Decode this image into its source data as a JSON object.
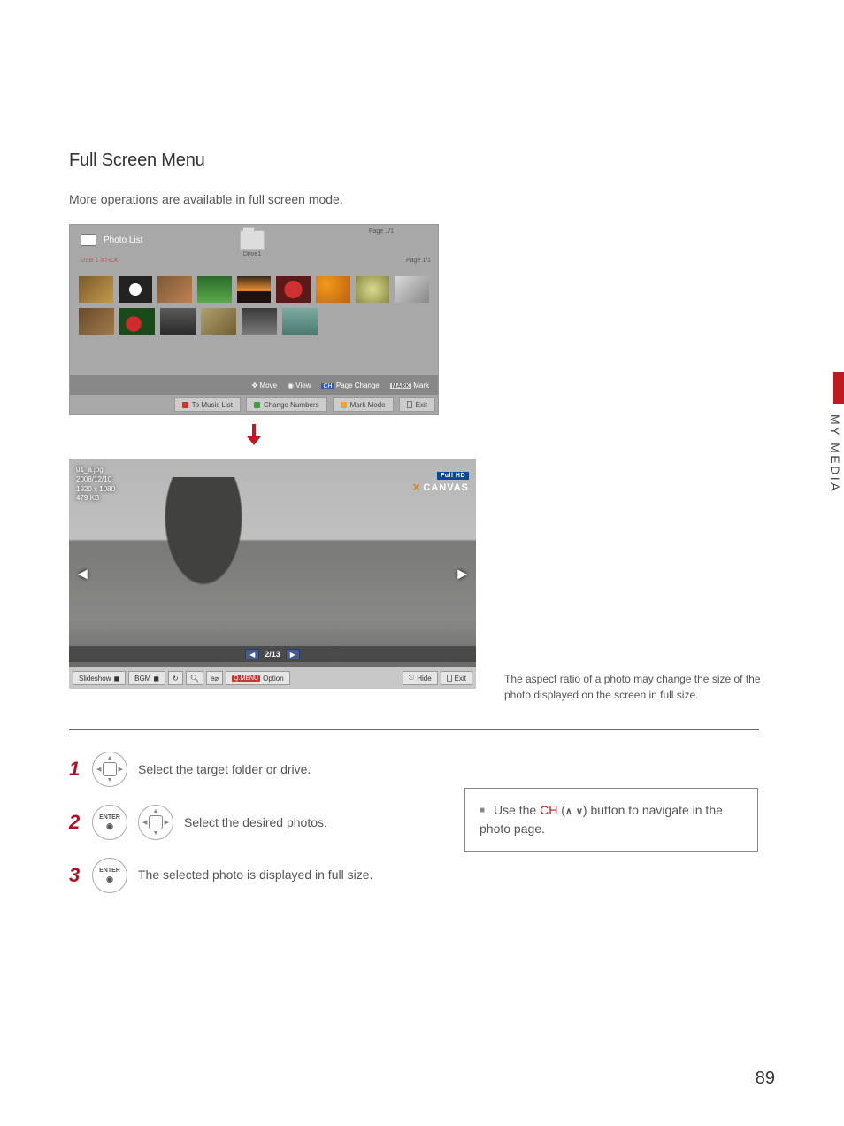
{
  "heading": "Full Screen Menu",
  "intro": "More operations are available in full screen mode.",
  "side_tab": "MY MEDIA",
  "page_number": "89",
  "photolist": {
    "title": "Photo List",
    "usb_label": "USB 1 XTICK",
    "drive_label": "Drive1",
    "page_top": "Page 1/1",
    "page_side": "Page 1/1",
    "hints": {
      "move": "Move",
      "view": "View",
      "page_change": "Page Change",
      "mark": "Mark",
      "mark_badge": "MARK"
    },
    "buttons": {
      "to_music": "To Music List",
      "change_numbers": "Change Numbers",
      "mark_mode": "Mark Mode",
      "exit": "Exit"
    }
  },
  "viewer": {
    "file": "01_a.jpg",
    "date": "2008/12/10",
    "resolution": "1920 x 1080",
    "size": "479 KB",
    "badge_hd": "Full HD",
    "badge_canvas": "CANVAS",
    "counter": "2/13",
    "toolbar": {
      "slideshow": "Slideshow",
      "bgm": "BGM",
      "option": "Option",
      "option_badge": "Q.MENU",
      "hide": "Hide",
      "exit": "Exit"
    }
  },
  "aspect_note": "The aspect ratio of a photo may change the size of the photo displayed on the screen in full size.",
  "steps": {
    "s1": "Select the target folder or drive.",
    "s2": "Select the desired photos.",
    "s3": "The selected photo is displayed in full size.",
    "enter": "ENTER"
  },
  "ch_hint": {
    "prefix": "Use the ",
    "ch": "CH",
    "mid": " (",
    "end": ") button to navigate in the photo page."
  }
}
